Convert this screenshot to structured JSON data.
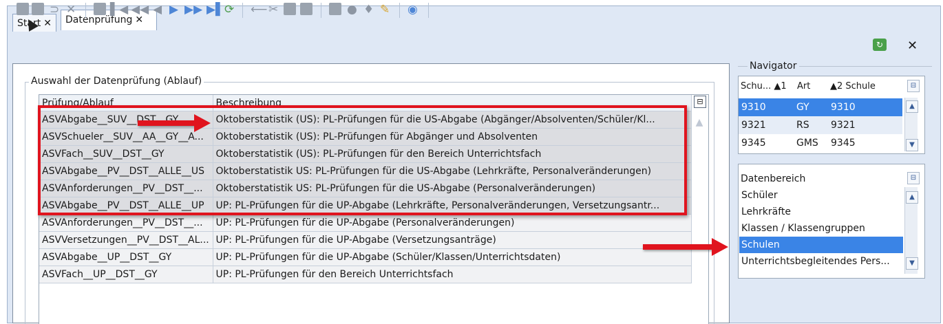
{
  "tabs": [
    {
      "label": "Start",
      "close": "✕"
    },
    {
      "label": "Datenprüfung",
      "close": "✕"
    }
  ],
  "toolbar": {
    "icons": [
      "save-icon",
      "save-all-icon",
      "undo-icon",
      "delete-icon",
      "new-icon",
      "first-icon",
      "prev-page-icon",
      "prev-icon",
      "next-icon",
      "next-page-icon",
      "last-icon",
      "refresh-icon",
      "link-icon",
      "cut-icon",
      "copy-icon",
      "paste-icon",
      "print-icon",
      "preview-icon",
      "bulb-icon",
      "broom-icon",
      "help-icon"
    ],
    "close": "✕"
  },
  "main": {
    "group_label": "Auswahl der Datenprüfung (Ablauf)",
    "columns": [
      "Prüfung/Ablauf",
      "Beschreibung"
    ],
    "rows": [
      {
        "pruefung": "ASVAbgabe__SUV__DST__GY",
        "beschreibung": "Oktoberstatistik (US): PL-Prüfungen für die US-Abgabe (Abgänger/Absolventen/Schüler/Kl..."
      },
      {
        "pruefung": "ASVSchueler__SUV__AA__GY__A...",
        "beschreibung": "Oktoberstatistik (US): PL-Prüfungen für Abgänger und Absolventen"
      },
      {
        "pruefung": "ASVFach__SUV__DST__GY",
        "beschreibung": "Oktoberstatistik (US): PL-Prüfungen für den Bereich Unterrichtsfach"
      },
      {
        "pruefung": "ASVAbgabe__PV__DST__ALLE__US",
        "beschreibung": "Oktoberstatistik US: PL-Prüfungen für die US-Abgabe (Lehrkräfte, Personalveränderungen)"
      },
      {
        "pruefung": "ASVAnforderungen__PV__DST__...",
        "beschreibung": "Oktoberstatistik US: PL-Prüfungen für die US-Abgabe (Personalveränderungen)"
      },
      {
        "pruefung": "ASVAbgabe__PV__DST__ALLE__UP",
        "beschreibung": "UP: PL-Prüfungen für die UP-Abgabe (Lehrkräfte, Personalveränderungen, Versetzungsantr..."
      },
      {
        "pruefung": "ASVAnforderungen__PV__DST__...",
        "beschreibung": "UP: PL-Prüfungen für die UP-Abgabe (Personalveränderungen)"
      },
      {
        "pruefung": "ASVVersetzungen__PV__DST__AL...",
        "beschreibung": "UP: PL-Prüfungen für die UP-Abgabe (Versetzungsanträge)"
      },
      {
        "pruefung": "ASVAbgabe__UP__DST__GY",
        "beschreibung": "UP: PL-Prüfungen für die UP-Abgabe (Schüler/Klassen/Unterrichtsdaten)"
      },
      {
        "pruefung": "ASVFach__UP__DST__GY",
        "beschreibung": "UP: PL-Prüfungen für den Bereich Unterrichtsfach"
      }
    ],
    "menu_icon": "grid-menu-icon"
  },
  "navigator": {
    "title": "Navigator",
    "headers": [
      "Schu... ▲1",
      "Art",
      "▲2 Schule"
    ],
    "rows": [
      {
        "schu": "9310",
        "art": "GY",
        "schule": "9310"
      },
      {
        "schu": "9321",
        "art": "RS",
        "schule": "9321"
      },
      {
        "schu": "9345",
        "art": "GMS",
        "schule": "9345"
      }
    ]
  },
  "datenbereich": {
    "title": "Datenbereich",
    "items": [
      "Schüler",
      "Lehrkräfte",
      "Klassen / Klassengruppen",
      "Schulen",
      "Unterrichtsbegleitendes Pers..."
    ],
    "selected": "Schulen"
  },
  "colors": {
    "accent_select": "#3a84e6",
    "annotation": "#e0141e"
  }
}
